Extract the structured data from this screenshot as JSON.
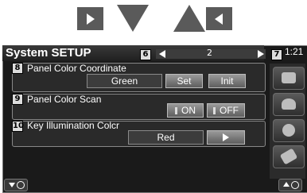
{
  "screen": {
    "title": "System SETUP",
    "clock": "1:21",
    "page_indicator": "2"
  },
  "callouts": [
    "6",
    "7",
    "8",
    "9",
    "10"
  ],
  "panels": [
    {
      "label": "Panel Color Coordinate",
      "value": "Green",
      "buttons": [
        "Set",
        "Init"
      ]
    },
    {
      "label": "Panel Color Scan",
      "toggle": [
        "ON",
        "OFF"
      ]
    },
    {
      "label": "Key Illumination Colcr",
      "value": "Red"
    }
  ],
  "icons": {
    "sidebar": [
      "grid-icon",
      "hand-icon",
      "disc-icon",
      "tools-icon"
    ],
    "nav_top": [
      "arrow-right-icon",
      "triangle-down-icon",
      "triangle-up-icon",
      "arrow-left-icon"
    ]
  },
  "colors": {
    "screen_bg": "#1a1a1a",
    "panel_bg": "#2a2a2a",
    "button_gray": "#7a7a7a",
    "text": "#ffffff",
    "nav_icon": "#5a5a5a"
  }
}
